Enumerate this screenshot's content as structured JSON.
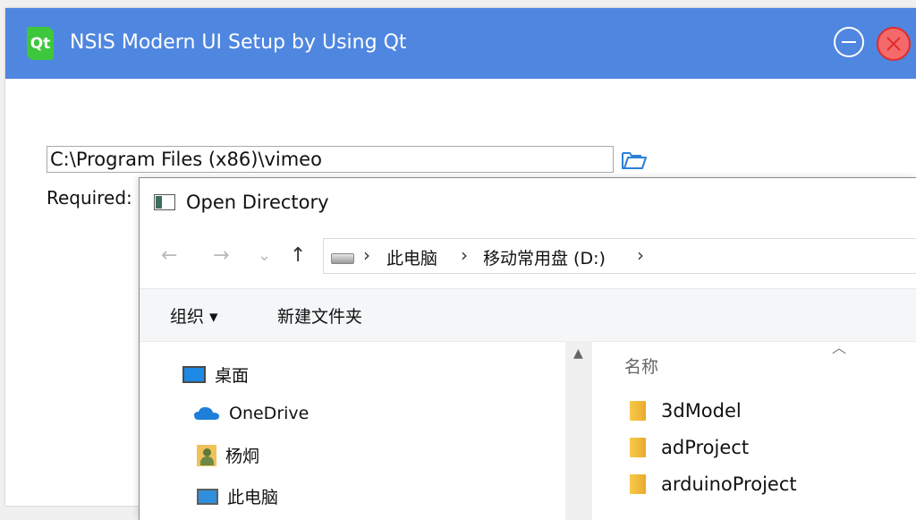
{
  "window": {
    "title": "NSIS Modern UI Setup by Using Qt",
    "logo_text": "Qt",
    "accent_color": "#4f86e0"
  },
  "installer": {
    "install_path": "C:\\Program Files (x86)\\vimeo",
    "required_label": "Required:"
  },
  "dialog": {
    "title": "Open Directory",
    "nav": {
      "back": "←",
      "forward": "→",
      "recent": "⌄",
      "up": "↑"
    },
    "breadcrumb": [
      "此电脑",
      "移动常用盘 (D:)"
    ],
    "breadcrumb_separator": "›",
    "toolbar": {
      "organize_label": "组织 ▾",
      "new_folder_label": "新建文件夹"
    },
    "nav_pane": [
      {
        "label": "桌面",
        "icon": "desktop-icon"
      },
      {
        "label": "OneDrive",
        "icon": "cloud-icon"
      },
      {
        "label": "杨炯",
        "icon": "user-folder-icon"
      },
      {
        "label": "此电脑",
        "icon": "computer-icon"
      }
    ],
    "file_list": {
      "column_header": "名称",
      "items": [
        "3dModel",
        "adProject",
        "arduinoProject"
      ]
    }
  }
}
